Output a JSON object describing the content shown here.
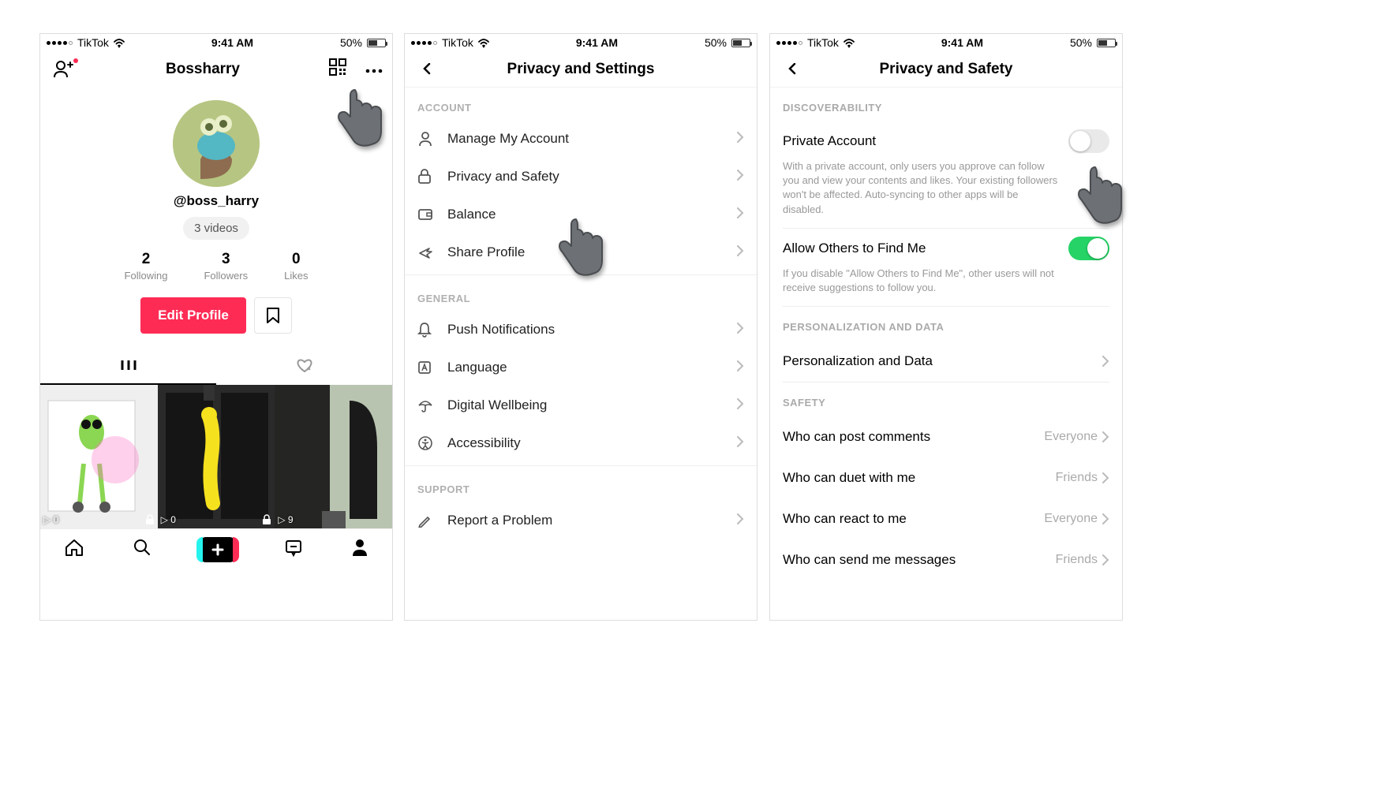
{
  "status": {
    "carrier": "TikTok",
    "time": "9:41 AM",
    "battery": "50%"
  },
  "profile": {
    "title": "Bossharry",
    "handle": "@boss_harry",
    "video_pill": "3 videos",
    "following_num": "2",
    "following_lbl": "Following",
    "followers_num": "3",
    "followers_lbl": "Followers",
    "likes_num": "0",
    "likes_lbl": "Likes",
    "edit_btn": "Edit Profile",
    "thumbs": [
      {
        "plays": "0"
      },
      {
        "plays": "0"
      },
      {
        "plays": "9"
      }
    ]
  },
  "settings": {
    "title": "Privacy and Settings",
    "sections": {
      "account_lbl": "ACCOUNT",
      "general_lbl": "GENERAL",
      "support_lbl": "SUPPORT"
    },
    "rows": {
      "manage": "Manage My Account",
      "privacy": "Privacy and Safety",
      "balance": "Balance",
      "share": "Share Profile",
      "push": "Push Notifications",
      "language": "Language",
      "wellbeing": "Digital Wellbeing",
      "accessibility": "Accessibility",
      "report": "Report a Problem"
    }
  },
  "privacy": {
    "title": "Privacy and Safety",
    "discoverability_lbl": "DISCOVERABILITY",
    "private_title": "Private Account",
    "private_desc": "With a private account, only users you approve can follow you and view your contents and likes. Your existing followers won't be affected. Auto-syncing to other apps will be disabled.",
    "allow_title": "Allow Others to Find Me",
    "allow_desc": "If you disable \"Allow Others to Find Me\", other users will not receive suggestions to follow you.",
    "personalization_lbl": "PERSONALIZATION AND DATA",
    "personalization_row": "Personalization and Data",
    "safety_lbl": "SAFETY",
    "safety_rows": {
      "comments_lbl": "Who can post comments",
      "comments_val": "Everyone",
      "duet_lbl": "Who can duet with me",
      "duet_val": "Friends",
      "react_lbl": "Who can react to me",
      "react_val": "Everyone",
      "msg_lbl": "Who can send me messages",
      "msg_val": "Friends"
    }
  }
}
